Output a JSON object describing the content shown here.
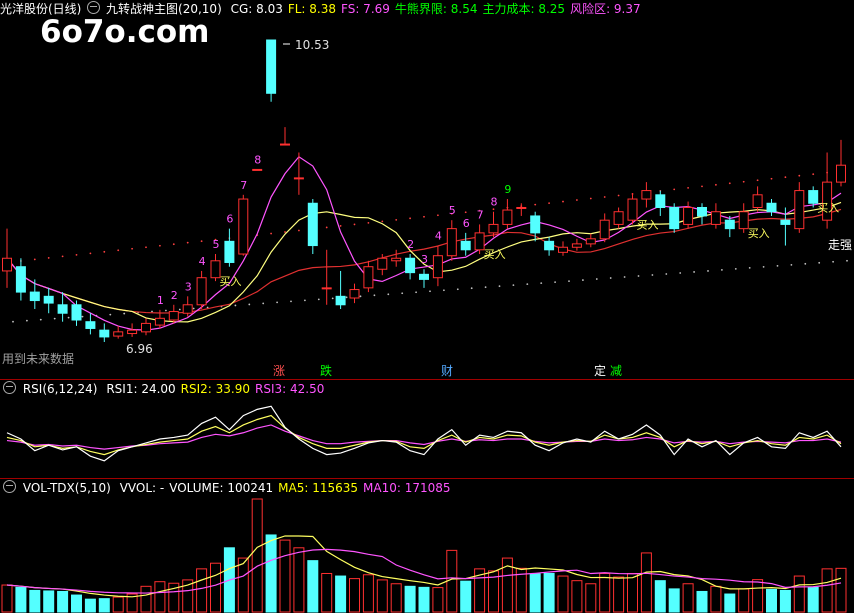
{
  "main": {
    "stock_name": "光洋股份(日线)",
    "indicator_icon": "circle-minus-icon",
    "indicator_name": "九转战神主图(20,10)",
    "fields": [
      {
        "label": "CG:",
        "value": "8.03",
        "color": "#ffffff"
      },
      {
        "label": "FL:",
        "value": "8.38",
        "color": "#ffff00"
      },
      {
        "label": "FS:",
        "value": "7.69",
        "color": "#ff55ff"
      },
      {
        "label": "牛熊界限:",
        "value": "8.54",
        "color": "#00ff00"
      },
      {
        "label": "主力成本:",
        "value": "8.25",
        "color": "#00ff00"
      },
      {
        "label": "风险区:",
        "value": "9.37",
        "color": "#ff55ff"
      }
    ],
    "watermark": "6o7o.com",
    "high_label": "10.53",
    "low_label": "6.96",
    "future_data_note": "用到未来数据",
    "buy_label": "买入",
    "strong_label": "走强",
    "countdown_8": "8",
    "signals": [
      {
        "text": "涨",
        "color": "#ff5050"
      },
      {
        "text": "跌",
        "color": "#00ff00"
      },
      {
        "text": "财",
        "color": "#55aaff"
      },
      {
        "text": "定",
        "color": "#ffffff"
      },
      {
        "text": "减",
        "color": "#00ff00"
      }
    ]
  },
  "rsi": {
    "title": "RSI(6,12,24)",
    "fields": [
      {
        "label": "RSI1:",
        "value": "24.00",
        "color": "#ffffff"
      },
      {
        "label": "RSI2:",
        "value": "33.90",
        "color": "#ffff00"
      },
      {
        "label": "RSI3:",
        "value": "42.50",
        "color": "#ff55ff"
      }
    ]
  },
  "vol": {
    "title": "VOL-TDX(5,10)",
    "fields": [
      {
        "label": "VVOL:",
        "value": "-",
        "color": "#ffffff"
      },
      {
        "label": "VOLUME:",
        "value": "100241",
        "color": "#ffffff"
      },
      {
        "label": "MA5:",
        "value": "115635",
        "color": "#ffff00"
      },
      {
        "label": "MA10:",
        "value": "171085",
        "color": "#ff55ff"
      }
    ]
  },
  "chart_data": {
    "type": "candlestick",
    "y_high": 10.53,
    "y_low": 6.96,
    "candles": [
      {
        "o": 7.8,
        "c": 7.95,
        "h": 8.3,
        "l": 7.6,
        "up": true
      },
      {
        "o": 7.85,
        "c": 7.55,
        "h": 7.95,
        "l": 7.45,
        "up": false
      },
      {
        "o": 7.55,
        "c": 7.45,
        "h": 7.7,
        "l": 7.35,
        "up": false
      },
      {
        "o": 7.5,
        "c": 7.42,
        "h": 7.6,
        "l": 7.3,
        "up": false
      },
      {
        "o": 7.4,
        "c": 7.3,
        "h": 7.55,
        "l": 7.2,
        "up": false
      },
      {
        "o": 7.4,
        "c": 7.22,
        "h": 7.45,
        "l": 7.15,
        "up": false
      },
      {
        "o": 7.2,
        "c": 7.12,
        "h": 7.3,
        "l": 7.05,
        "up": false
      },
      {
        "o": 7.1,
        "c": 7.02,
        "h": 7.18,
        "l": 6.96,
        "up": false
      },
      {
        "o": 7.03,
        "c": 7.08,
        "h": 7.15,
        "l": 7.0,
        "up": true
      },
      {
        "o": 7.06,
        "c": 7.1,
        "h": 7.18,
        "l": 7.02,
        "up": true
      },
      {
        "o": 7.08,
        "c": 7.18,
        "h": 7.24,
        "l": 7.04,
        "up": true
      },
      {
        "o": 7.16,
        "c": 7.24,
        "h": 7.34,
        "l": 7.12,
        "up": true
      },
      {
        "o": 7.22,
        "c": 7.32,
        "h": 7.4,
        "l": 7.18,
        "up": true
      },
      {
        "o": 7.3,
        "c": 7.4,
        "h": 7.5,
        "l": 7.26,
        "up": true
      },
      {
        "o": 7.4,
        "c": 7.72,
        "h": 7.8,
        "l": 7.35,
        "up": true
      },
      {
        "o": 7.72,
        "c": 7.92,
        "h": 8.0,
        "l": 7.68,
        "up": true
      },
      {
        "o": 8.15,
        "c": 7.9,
        "h": 8.3,
        "l": 7.85,
        "up": false
      },
      {
        "o": 8.0,
        "c": 8.65,
        "h": 8.7,
        "l": 7.98,
        "up": true
      },
      {
        "o": 9.0,
        "c": 9.0,
        "h": 9.0,
        "l": 9.0,
        "up": true
      },
      {
        "o": 10.53,
        "c": 9.9,
        "h": 10.53,
        "l": 9.8,
        "up": false
      },
      {
        "o": 9.3,
        "c": 9.3,
        "h": 9.5,
        "l": 9.3,
        "up": true
      },
      {
        "o": 8.9,
        "c": 8.9,
        "h": 9.2,
        "l": 8.7,
        "up": true
      },
      {
        "o": 8.6,
        "c": 8.1,
        "h": 8.65,
        "l": 8.0,
        "up": false
      },
      {
        "o": 7.6,
        "c": 7.6,
        "h": 8.05,
        "l": 7.4,
        "up": true
      },
      {
        "o": 7.5,
        "c": 7.4,
        "h": 7.8,
        "l": 7.35,
        "up": false
      },
      {
        "o": 7.48,
        "c": 7.58,
        "h": 7.65,
        "l": 7.42,
        "up": true
      },
      {
        "o": 7.6,
        "c": 7.85,
        "h": 7.92,
        "l": 7.55,
        "up": true
      },
      {
        "o": 7.82,
        "c": 7.95,
        "h": 8.0,
        "l": 7.75,
        "up": true
      },
      {
        "o": 7.92,
        "c": 7.95,
        "h": 8.05,
        "l": 7.85,
        "up": true
      },
      {
        "o": 7.95,
        "c": 7.78,
        "h": 8.0,
        "l": 7.7,
        "up": false
      },
      {
        "o": 7.76,
        "c": 7.7,
        "h": 7.82,
        "l": 7.6,
        "up": false
      },
      {
        "o": 7.72,
        "c": 7.98,
        "h": 8.1,
        "l": 7.62,
        "up": true
      },
      {
        "o": 7.98,
        "c": 8.3,
        "h": 8.4,
        "l": 7.92,
        "up": true
      },
      {
        "o": 8.15,
        "c": 8.05,
        "h": 8.25,
        "l": 7.98,
        "up": false
      },
      {
        "o": 8.05,
        "c": 8.25,
        "h": 8.35,
        "l": 8.0,
        "up": true
      },
      {
        "o": 8.25,
        "c": 8.35,
        "h": 8.5,
        "l": 8.2,
        "up": true
      },
      {
        "o": 8.35,
        "c": 8.52,
        "h": 8.65,
        "l": 8.3,
        "up": true
      },
      {
        "o": 8.55,
        "c": 8.55,
        "h": 8.6,
        "l": 8.45,
        "up": true
      },
      {
        "o": 8.45,
        "c": 8.25,
        "h": 8.5,
        "l": 8.15,
        "up": false
      },
      {
        "o": 8.15,
        "c": 8.05,
        "h": 8.2,
        "l": 7.98,
        "up": false
      },
      {
        "o": 8.02,
        "c": 8.08,
        "h": 8.15,
        "l": 7.98,
        "up": true
      },
      {
        "o": 8.08,
        "c": 8.12,
        "h": 8.18,
        "l": 8.04,
        "up": true
      },
      {
        "o": 8.12,
        "c": 8.18,
        "h": 8.24,
        "l": 8.08,
        "up": true
      },
      {
        "o": 8.18,
        "c": 8.4,
        "h": 8.48,
        "l": 8.14,
        "up": true
      },
      {
        "o": 8.35,
        "c": 8.5,
        "h": 8.55,
        "l": 8.3,
        "up": true
      },
      {
        "o": 8.4,
        "c": 8.65,
        "h": 8.72,
        "l": 8.35,
        "up": true
      },
      {
        "o": 8.65,
        "c": 8.75,
        "h": 8.85,
        "l": 8.55,
        "up": true
      },
      {
        "o": 8.7,
        "c": 8.55,
        "h": 8.75,
        "l": 8.45,
        "up": false
      },
      {
        "o": 8.55,
        "c": 8.3,
        "h": 8.6,
        "l": 8.25,
        "up": false
      },
      {
        "o": 8.35,
        "c": 8.55,
        "h": 8.62,
        "l": 8.3,
        "up": true
      },
      {
        "o": 8.55,
        "c": 8.45,
        "h": 8.6,
        "l": 8.35,
        "up": false
      },
      {
        "o": 8.35,
        "c": 8.5,
        "h": 8.6,
        "l": 8.3,
        "up": true
      },
      {
        "o": 8.4,
        "c": 8.3,
        "h": 8.45,
        "l": 8.2,
        "up": false
      },
      {
        "o": 8.3,
        "c": 8.5,
        "h": 8.6,
        "l": 8.25,
        "up": true
      },
      {
        "o": 8.55,
        "c": 8.7,
        "h": 8.8,
        "l": 8.5,
        "up": true
      },
      {
        "o": 8.6,
        "c": 8.5,
        "h": 8.65,
        "l": 8.45,
        "up": false
      },
      {
        "o": 8.4,
        "c": 8.35,
        "h": 8.55,
        "l": 8.1,
        "up": false
      },
      {
        "o": 8.3,
        "c": 8.75,
        "h": 8.85,
        "l": 8.25,
        "up": true
      },
      {
        "o": 8.75,
        "c": 8.6,
        "h": 8.8,
        "l": 8.55,
        "up": false
      },
      {
        "o": 8.4,
        "c": 8.85,
        "h": 9.2,
        "l": 8.3,
        "up": true
      },
      {
        "o": 8.85,
        "c": 9.05,
        "h": 9.35,
        "l": 8.8,
        "up": true
      }
    ],
    "volume": [
      {
        "v": 105,
        "up": true
      },
      {
        "v": 96,
        "up": false
      },
      {
        "v": 84,
        "up": false
      },
      {
        "v": 82,
        "up": false
      },
      {
        "v": 80,
        "up": false
      },
      {
        "v": 66,
        "up": false
      },
      {
        "v": 50,
        "up": false
      },
      {
        "v": 52,
        "up": false
      },
      {
        "v": 58,
        "up": true
      },
      {
        "v": 70,
        "up": true
      },
      {
        "v": 100,
        "up": true
      },
      {
        "v": 118,
        "up": true
      },
      {
        "v": 112,
        "up": true
      },
      {
        "v": 125,
        "up": true
      },
      {
        "v": 168,
        "up": true
      },
      {
        "v": 190,
        "up": true
      },
      {
        "v": 250,
        "up": false
      },
      {
        "v": 210,
        "up": true
      },
      {
        "v": 440,
        "up": true
      },
      {
        "v": 300,
        "up": false
      },
      {
        "v": 280,
        "up": true
      },
      {
        "v": 250,
        "up": true
      },
      {
        "v": 200,
        "up": false
      },
      {
        "v": 150,
        "up": true
      },
      {
        "v": 140,
        "up": false
      },
      {
        "v": 130,
        "up": true
      },
      {
        "v": 145,
        "up": true
      },
      {
        "v": 125,
        "up": true
      },
      {
        "v": 110,
        "up": true
      },
      {
        "v": 100,
        "up": false
      },
      {
        "v": 96,
        "up": false
      },
      {
        "v": 95,
        "up": true
      },
      {
        "v": 240,
        "up": true
      },
      {
        "v": 120,
        "up": false
      },
      {
        "v": 168,
        "up": true
      },
      {
        "v": 160,
        "up": true
      },
      {
        "v": 210,
        "up": true
      },
      {
        "v": 170,
        "up": true
      },
      {
        "v": 148,
        "up": false
      },
      {
        "v": 150,
        "up": false
      },
      {
        "v": 140,
        "up": true
      },
      {
        "v": 122,
        "up": true
      },
      {
        "v": 110,
        "up": true
      },
      {
        "v": 150,
        "up": true
      },
      {
        "v": 136,
        "up": true
      },
      {
        "v": 150,
        "up": true
      },
      {
        "v": 230,
        "up": true
      },
      {
        "v": 122,
        "up": false
      },
      {
        "v": 90,
        "up": false
      },
      {
        "v": 110,
        "up": true
      },
      {
        "v": 80,
        "up": false
      },
      {
        "v": 100,
        "up": true
      },
      {
        "v": 70,
        "up": false
      },
      {
        "v": 90,
        "up": true
      },
      {
        "v": 126,
        "up": true
      },
      {
        "v": 88,
        "up": false
      },
      {
        "v": 84,
        "up": false
      },
      {
        "v": 140,
        "up": true
      },
      {
        "v": 96,
        "up": false
      },
      {
        "v": 168,
        "up": true
      },
      {
        "v": 170,
        "up": true
      }
    ],
    "rsi1": [
      58,
      50,
      35,
      42,
      36,
      40,
      28,
      22,
      35,
      40,
      45,
      50,
      52,
      55,
      70,
      78,
      62,
      80,
      88,
      92,
      65,
      50,
      38,
      30,
      32,
      38,
      45,
      48,
      46,
      35,
      30,
      50,
      62,
      42,
      55,
      52,
      60,
      58,
      42,
      35,
      45,
      50,
      46,
      60,
      50,
      56,
      68,
      55,
      30,
      50,
      40,
      48,
      30,
      45,
      52,
      40,
      38,
      58,
      52,
      60,
      40
    ],
    "rsi2": [
      52,
      48,
      40,
      42,
      38,
      40,
      34,
      30,
      36,
      40,
      43,
      46,
      48,
      50,
      60,
      66,
      58,
      68,
      75,
      80,
      64,
      52,
      44,
      38,
      38,
      42,
      46,
      48,
      47,
      40,
      38,
      48,
      55,
      46,
      52,
      50,
      55,
      54,
      46,
      42,
      46,
      48,
      47,
      55,
      50,
      52,
      58,
      52,
      40,
      48,
      44,
      47,
      40,
      45,
      48,
      44,
      42,
      52,
      50,
      55,
      44
    ],
    "rsi3": [
      48,
      46,
      42,
      43,
      41,
      42,
      39,
      37,
      39,
      41,
      42,
      44,
      45,
      46,
      52,
      56,
      54,
      58,
      64,
      68,
      60,
      54,
      48,
      44,
      44,
      46,
      47,
      48,
      48,
      45,
      43,
      47,
      50,
      47,
      49,
      48,
      50,
      50,
      47,
      45,
      46,
      47,
      47,
      50,
      48,
      49,
      52,
      50,
      45,
      47,
      46,
      47,
      44,
      46,
      47,
      46,
      45,
      48,
      48,
      50,
      46
    ]
  }
}
